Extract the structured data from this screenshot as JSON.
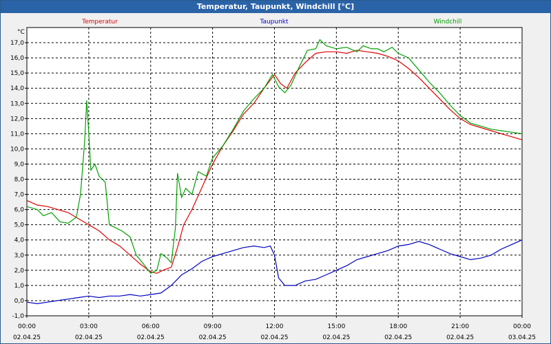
{
  "window": {
    "title": "Temperatur, Taupunkt, Windchill [°C]"
  },
  "chart_data": {
    "type": "line",
    "title": "Temperatur, Taupunkt, Windchill [°C]",
    "ylabel": "°C",
    "ylim": [
      -1.0,
      18.0
    ],
    "yticks": [
      "-1,0",
      "0,0",
      "1,0",
      "2,0",
      "3,0",
      "4,0",
      "5,0",
      "6,0",
      "7,0",
      "8,0",
      "9,0",
      "10,0",
      "11,0",
      "12,0",
      "13,0",
      "14,0",
      "15,0",
      "16,0",
      "17,0"
    ],
    "xlim": [
      0,
      24
    ],
    "xticks": [
      {
        "time": "00:00",
        "date": "02.04.25"
      },
      {
        "time": "03:00",
        "date": "02.04.25"
      },
      {
        "time": "06:00",
        "date": "02.04.25"
      },
      {
        "time": "09:00",
        "date": "02.04.25"
      },
      {
        "time": "12:00",
        "date": "02.04.25"
      },
      {
        "time": "15:00",
        "date": "02.04.25"
      },
      {
        "time": "18:00",
        "date": "02.04.25"
      },
      {
        "time": "21:00",
        "date": "02.04.25"
      },
      {
        "time": "00:00",
        "date": "03.04.25"
      }
    ],
    "grid": true,
    "legend_placement": "top",
    "series": [
      {
        "name": "Temperatur",
        "color": "#e00000",
        "points": [
          [
            0,
            6.6
          ],
          [
            0.5,
            6.3
          ],
          [
            1,
            6.2
          ],
          [
            1.5,
            6.0
          ],
          [
            2,
            5.8
          ],
          [
            2.5,
            5.4
          ],
          [
            3,
            5.0
          ],
          [
            3.5,
            4.6
          ],
          [
            4,
            4.0
          ],
          [
            4.5,
            3.6
          ],
          [
            5,
            3.0
          ],
          [
            5.5,
            2.4
          ],
          [
            6,
            1.9
          ],
          [
            6.3,
            1.8
          ],
          [
            6.6,
            2.0
          ],
          [
            7,
            2.2
          ],
          [
            7.3,
            3.5
          ],
          [
            7.6,
            5.0
          ],
          [
            8,
            6.0
          ],
          [
            8.5,
            7.5
          ],
          [
            9,
            9.0
          ],
          [
            9.5,
            10.2
          ],
          [
            10,
            11.2
          ],
          [
            10.5,
            12.3
          ],
          [
            11,
            13.0
          ],
          [
            11.5,
            14.0
          ],
          [
            12,
            14.9
          ],
          [
            12.3,
            14.3
          ],
          [
            12.6,
            14.0
          ],
          [
            13,
            15.0
          ],
          [
            13.5,
            15.7
          ],
          [
            14,
            16.3
          ],
          [
            14.5,
            16.4
          ],
          [
            15,
            16.4
          ],
          [
            15.5,
            16.3
          ],
          [
            16,
            16.5
          ],
          [
            16.5,
            16.4
          ],
          [
            17,
            16.3
          ],
          [
            17.5,
            16.1
          ],
          [
            18,
            15.8
          ],
          [
            18.5,
            15.3
          ],
          [
            19,
            14.7
          ],
          [
            19.5,
            14.0
          ],
          [
            20,
            13.3
          ],
          [
            20.5,
            12.6
          ],
          [
            21,
            12.0
          ],
          [
            21.5,
            11.6
          ],
          [
            22,
            11.4
          ],
          [
            22.5,
            11.2
          ],
          [
            23,
            11.0
          ],
          [
            23.5,
            10.8
          ],
          [
            24,
            10.6
          ]
        ]
      },
      {
        "name": "Taupunkt",
        "color": "#0000c0",
        "points": [
          [
            0,
            -0.1
          ],
          [
            0.5,
            -0.2
          ],
          [
            1,
            -0.1
          ],
          [
            1.5,
            0.0
          ],
          [
            2,
            0.1
          ],
          [
            2.5,
            0.2
          ],
          [
            3,
            0.3
          ],
          [
            3.5,
            0.2
          ],
          [
            4,
            0.3
          ],
          [
            4.5,
            0.3
          ],
          [
            5,
            0.4
          ],
          [
            5.5,
            0.3
          ],
          [
            6,
            0.4
          ],
          [
            6.5,
            0.5
          ],
          [
            7,
            1.0
          ],
          [
            7.5,
            1.7
          ],
          [
            8,
            2.1
          ],
          [
            8.5,
            2.6
          ],
          [
            9,
            2.9
          ],
          [
            9.5,
            3.1
          ],
          [
            10,
            3.3
          ],
          [
            10.5,
            3.5
          ],
          [
            11,
            3.6
          ],
          [
            11.5,
            3.5
          ],
          [
            11.8,
            3.6
          ],
          [
            12,
            3.0
          ],
          [
            12.2,
            1.5
          ],
          [
            12.5,
            1.0
          ],
          [
            13,
            1.0
          ],
          [
            13.5,
            1.3
          ],
          [
            14,
            1.4
          ],
          [
            14.5,
            1.7
          ],
          [
            15,
            2.0
          ],
          [
            15.5,
            2.3
          ],
          [
            16,
            2.7
          ],
          [
            16.5,
            2.9
          ],
          [
            17,
            3.1
          ],
          [
            17.5,
            3.3
          ],
          [
            18,
            3.6
          ],
          [
            18.5,
            3.7
          ],
          [
            19,
            3.9
          ],
          [
            19.5,
            3.7
          ],
          [
            20,
            3.4
          ],
          [
            20.5,
            3.1
          ],
          [
            21,
            2.9
          ],
          [
            21.5,
            2.7
          ],
          [
            22,
            2.8
          ],
          [
            22.5,
            3.0
          ],
          [
            23,
            3.4
          ],
          [
            23.5,
            3.7
          ],
          [
            24,
            4.0
          ]
        ]
      },
      {
        "name": "Windchill",
        "color": "#00a000",
        "points": [
          [
            0,
            6.2
          ],
          [
            0.5,
            6.0
          ],
          [
            0.8,
            5.6
          ],
          [
            1.2,
            5.8
          ],
          [
            1.6,
            5.2
          ],
          [
            2,
            5.1
          ],
          [
            2.4,
            5.5
          ],
          [
            2.6,
            7.0
          ],
          [
            2.8,
            10.5
          ],
          [
            2.9,
            13.2
          ],
          [
            3.0,
            11.0
          ],
          [
            3.1,
            8.6
          ],
          [
            3.3,
            9.0
          ],
          [
            3.5,
            8.2
          ],
          [
            3.8,
            7.8
          ],
          [
            4.0,
            5.0
          ],
          [
            4.3,
            4.8
          ],
          [
            4.6,
            4.6
          ],
          [
            5,
            4.2
          ],
          [
            5.3,
            3.0
          ],
          [
            5.6,
            2.5
          ],
          [
            6,
            1.8
          ],
          [
            6.3,
            2.0
          ],
          [
            6.5,
            3.1
          ],
          [
            6.8,
            2.8
          ],
          [
            7.0,
            2.5
          ],
          [
            7.2,
            4.8
          ],
          [
            7.3,
            8.4
          ],
          [
            7.5,
            6.8
          ],
          [
            7.7,
            7.4
          ],
          [
            8,
            7.0
          ],
          [
            8.3,
            8.5
          ],
          [
            8.7,
            8.2
          ],
          [
            9,
            9.4
          ],
          [
            9.5,
            10.2
          ],
          [
            10,
            11.3
          ],
          [
            10.5,
            12.5
          ],
          [
            11,
            13.3
          ],
          [
            11.5,
            14.0
          ],
          [
            11.9,
            14.9
          ],
          [
            12.2,
            14.1
          ],
          [
            12.5,
            13.7
          ],
          [
            12.8,
            14.2
          ],
          [
            13.2,
            15.4
          ],
          [
            13.6,
            16.5
          ],
          [
            14,
            16.6
          ],
          [
            14.2,
            17.2
          ],
          [
            14.5,
            16.8
          ],
          [
            15,
            16.6
          ],
          [
            15.5,
            16.7
          ],
          [
            16,
            16.4
          ],
          [
            16.3,
            16.8
          ],
          [
            16.7,
            16.6
          ],
          [
            17,
            16.6
          ],
          [
            17.3,
            16.4
          ],
          [
            17.7,
            16.7
          ],
          [
            18,
            16.3
          ],
          [
            18.5,
            16.0
          ],
          [
            19,
            15.2
          ],
          [
            19.5,
            14.4
          ],
          [
            20,
            13.7
          ],
          [
            20.5,
            12.9
          ],
          [
            21,
            12.2
          ],
          [
            21.5,
            11.7
          ],
          [
            22,
            11.5
          ],
          [
            22.5,
            11.3
          ],
          [
            23,
            11.2
          ],
          [
            23.5,
            11.1
          ],
          [
            24,
            11.0
          ]
        ]
      }
    ]
  }
}
